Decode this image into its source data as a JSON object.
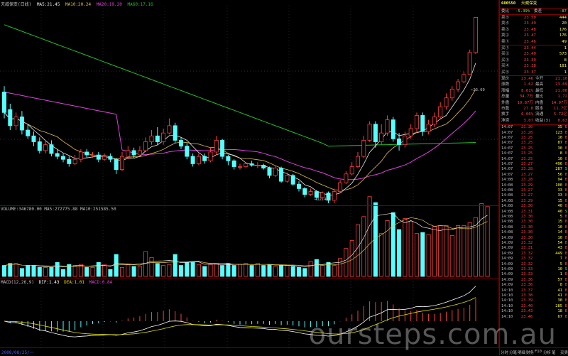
{
  "header": {
    "name": "天威保变(日线)",
    "ma5": "MA5:21.45",
    "ma10": "MA10:20.24",
    "ma20": "MA20:19.20",
    "ma60": "MA60:17.16"
  },
  "price_labels": {
    "high": "23.69",
    "low": "12.40"
  },
  "volume_header": "VOLUME:346780.00  MA5:272775.88  MA10:251585.50",
  "macd_header": {
    "params": "MACD(12,26,9)",
    "dif": "DIF:1.43",
    "dea": "DEA:1.01",
    "macd": "MACD:0.84"
  },
  "axis_date": "2008/08/25/一",
  "colors": {
    "up": "#ff3c3c",
    "down": "#54ffff",
    "ma5": "#e8e8e8",
    "ma10": "#e0c040",
    "ma20": "#e040e0",
    "ma60": "#20c020",
    "macd_dif": "#ffffff",
    "macd_dea": "#e0e000",
    "border": "#800000"
  },
  "candles": [
    {
      "o": 18.6,
      "c": 17.2,
      "h": 19.0,
      "l": 16.8
    },
    {
      "o": 17.4,
      "c": 16.3,
      "h": 17.8,
      "l": 16.0
    },
    {
      "o": 16.3,
      "c": 16.9,
      "h": 17.2,
      "l": 16.0
    },
    {
      "o": 16.9,
      "c": 16.0,
      "h": 17.3,
      "l": 15.7
    },
    {
      "o": 16.0,
      "c": 15.6,
      "h": 16.4,
      "l": 15.4
    },
    {
      "o": 15.6,
      "c": 15.2,
      "h": 15.9,
      "l": 14.9
    },
    {
      "o": 15.2,
      "c": 14.6,
      "h": 15.5,
      "l": 14.4
    },
    {
      "o": 14.6,
      "c": 15.0,
      "h": 15.3,
      "l": 14.4
    },
    {
      "o": 15.0,
      "c": 14.4,
      "h": 15.3,
      "l": 14.2
    },
    {
      "o": 14.4,
      "c": 14.2,
      "h": 14.7,
      "l": 14.0
    },
    {
      "o": 14.2,
      "c": 14.0,
      "h": 14.4,
      "l": 13.8
    },
    {
      "o": 14.0,
      "c": 13.7,
      "h": 14.2,
      "l": 13.5
    },
    {
      "o": 13.7,
      "c": 14.0,
      "h": 14.3,
      "l": 13.6
    },
    {
      "o": 14.0,
      "c": 14.5,
      "h": 14.7,
      "l": 13.8
    },
    {
      "o": 14.5,
      "c": 14.3,
      "h": 14.7,
      "l": 14.1
    },
    {
      "o": 14.3,
      "c": 14.3,
      "h": 14.5,
      "l": 14.1
    },
    {
      "o": 14.3,
      "c": 14.0,
      "h": 14.5,
      "l": 13.8
    },
    {
      "o": 14.0,
      "c": 14.2,
      "h": 14.4,
      "l": 13.9
    },
    {
      "o": 14.2,
      "c": 14.0,
      "h": 14.4,
      "l": 13.8
    },
    {
      "o": 14.0,
      "c": 13.3,
      "h": 14.1,
      "l": 13.0
    },
    {
      "o": 13.3,
      "c": 14.2,
      "h": 14.5,
      "l": 13.2
    },
    {
      "o": 14.2,
      "c": 14.6,
      "h": 14.9,
      "l": 14.0
    },
    {
      "o": 14.6,
      "c": 14.3,
      "h": 14.8,
      "l": 14.1
    },
    {
      "o": 14.3,
      "c": 14.6,
      "h": 14.9,
      "l": 14.2
    },
    {
      "o": 14.6,
      "c": 15.2,
      "h": 15.5,
      "l": 14.5
    },
    {
      "o": 15.2,
      "c": 15.6,
      "h": 16.0,
      "l": 15.0
    },
    {
      "o": 15.6,
      "c": 15.2,
      "h": 16.2,
      "l": 15.0
    },
    {
      "o": 15.2,
      "c": 15.8,
      "h": 16.1,
      "l": 15.0
    },
    {
      "o": 15.8,
      "c": 16.3,
      "h": 16.8,
      "l": 15.7
    },
    {
      "o": 16.3,
      "c": 15.3,
      "h": 16.5,
      "l": 15.1
    },
    {
      "o": 15.3,
      "c": 14.9,
      "h": 15.5,
      "l": 14.7
    },
    {
      "o": 14.9,
      "c": 14.2,
      "h": 15.1,
      "l": 14.0
    },
    {
      "o": 14.2,
      "c": 13.7,
      "h": 14.4,
      "l": 13.5
    },
    {
      "o": 13.7,
      "c": 14.2,
      "h": 14.4,
      "l": 13.6
    },
    {
      "o": 14.2,
      "c": 13.9,
      "h": 14.4,
      "l": 13.7
    },
    {
      "o": 13.9,
      "c": 14.5,
      "h": 14.8,
      "l": 13.8
    },
    {
      "o": 14.5,
      "c": 15.3,
      "h": 15.6,
      "l": 14.3
    },
    {
      "o": 15.3,
      "c": 14.2,
      "h": 15.4,
      "l": 14.0
    },
    {
      "o": 14.2,
      "c": 13.9,
      "h": 14.3,
      "l": 13.6
    },
    {
      "o": 13.9,
      "c": 13.5,
      "h": 14.0,
      "l": 13.3
    },
    {
      "o": 13.5,
      "c": 13.5,
      "h": 13.7,
      "l": 13.3
    },
    {
      "o": 13.5,
      "c": 13.7,
      "h": 13.8,
      "l": 13.4
    },
    {
      "o": 13.7,
      "c": 13.6,
      "h": 13.9,
      "l": 13.5
    },
    {
      "o": 13.6,
      "c": 13.6,
      "h": 13.8,
      "l": 13.4
    },
    {
      "o": 13.6,
      "c": 13.4,
      "h": 13.7,
      "l": 13.3
    },
    {
      "o": 13.4,
      "c": 12.9,
      "h": 13.5,
      "l": 12.7
    },
    {
      "o": 12.9,
      "c": 13.4,
      "h": 13.6,
      "l": 12.8
    },
    {
      "o": 13.4,
      "c": 12.5,
      "h": 13.5,
      "l": 12.4
    },
    {
      "o": 12.5,
      "c": 12.9,
      "h": 13.1,
      "l": 12.4
    },
    {
      "o": 12.9,
      "c": 12.3,
      "h": 13.0,
      "l": 12.2
    },
    {
      "o": 12.3,
      "c": 12.0,
      "h": 12.5,
      "l": 11.8
    },
    {
      "o": 12.0,
      "c": 11.6,
      "h": 12.1,
      "l": 11.4
    },
    {
      "o": 11.6,
      "c": 11.8,
      "h": 12.0,
      "l": 11.5
    },
    {
      "o": 11.8,
      "c": 11.4,
      "h": 11.9,
      "l": 11.2
    },
    {
      "o": 11.4,
      "c": 11.7,
      "h": 11.8,
      "l": 11.2
    },
    {
      "o": 11.7,
      "c": 11.2,
      "h": 11.8,
      "l": 11.0
    },
    {
      "o": 11.2,
      "c": 11.8,
      "h": 12.0,
      "l": 11.0
    },
    {
      "o": 11.8,
      "c": 12.4,
      "h": 12.6,
      "l": 11.7
    },
    {
      "o": 12.4,
      "c": 13.0,
      "h": 13.2,
      "l": 12.3
    },
    {
      "o": 13.0,
      "c": 13.5,
      "h": 13.8,
      "l": 12.9
    },
    {
      "o": 13.5,
      "c": 14.2,
      "h": 14.5,
      "l": 13.4
    },
    {
      "o": 14.2,
      "c": 15.3,
      "h": 15.6,
      "l": 14.1
    },
    {
      "o": 15.3,
      "c": 16.4,
      "h": 16.6,
      "l": 15.2
    },
    {
      "o": 16.4,
      "c": 15.2,
      "h": 16.6,
      "l": 14.8
    },
    {
      "o": 15.2,
      "c": 15.8,
      "h": 16.4,
      "l": 15.0
    },
    {
      "o": 15.8,
      "c": 16.7,
      "h": 17.0,
      "l": 15.6
    },
    {
      "o": 16.7,
      "c": 15.4,
      "h": 16.9,
      "l": 15.2
    },
    {
      "o": 15.4,
      "c": 15.0,
      "h": 15.8,
      "l": 14.6
    },
    {
      "o": 15.0,
      "c": 15.6,
      "h": 15.9,
      "l": 14.8
    },
    {
      "o": 15.6,
      "c": 16.1,
      "h": 16.4,
      "l": 15.4
    },
    {
      "o": 16.1,
      "c": 17.0,
      "h": 17.2,
      "l": 15.8
    },
    {
      "o": 17.0,
      "c": 15.9,
      "h": 17.2,
      "l": 15.6
    },
    {
      "o": 15.9,
      "c": 16.4,
      "h": 16.7,
      "l": 15.7
    },
    {
      "o": 16.4,
      "c": 16.9,
      "h": 17.2,
      "l": 16.2
    },
    {
      "o": 16.9,
      "c": 17.6,
      "h": 17.9,
      "l": 16.8
    },
    {
      "o": 17.6,
      "c": 18.2,
      "h": 18.5,
      "l": 17.4
    },
    {
      "o": 18.2,
      "c": 18.8,
      "h": 19.0,
      "l": 18.0
    },
    {
      "o": 18.8,
      "c": 19.3,
      "h": 19.5,
      "l": 18.6
    },
    {
      "o": 19.3,
      "c": 19.8,
      "h": 20.0,
      "l": 19.2
    },
    {
      "o": 19.8,
      "c": 21.3,
      "h": 21.5,
      "l": 19.8
    },
    {
      "o": 21.3,
      "c": 23.7,
      "h": 23.7,
      "l": 21.2
    }
  ],
  "volumes": [
    11,
    13,
    13,
    8,
    11,
    11,
    9,
    9,
    9,
    14,
    7,
    12,
    11,
    12,
    9,
    9,
    14,
    12,
    7,
    22,
    9,
    12,
    10,
    10,
    25,
    19,
    13,
    11,
    12,
    22,
    11,
    14,
    14,
    12,
    10,
    12,
    13,
    11,
    13,
    11,
    12,
    13,
    11,
    13,
    11,
    12,
    10,
    11,
    11,
    10,
    9,
    8,
    15,
    17,
    11,
    14,
    11,
    18,
    28,
    36,
    52,
    60,
    80,
    74,
    43,
    56,
    64,
    47,
    58,
    55,
    43,
    44,
    42,
    50,
    51,
    51,
    41,
    51,
    51,
    54,
    59,
    73,
    70
  ],
  "quote": {
    "code": "600550",
    "name": "天威保变",
    "weibi_label": "委比",
    "weibi_val": "-5.39%",
    "weicha_label": "委差",
    "weicha_val": "-87",
    "sells": [
      {
        "label": "卖⑤",
        "price": "23.50",
        "vol": "444"
      },
      {
        "label": "卖④",
        "price": "23.49",
        "vol": "20"
      },
      {
        "label": "卖③",
        "price": "23.48",
        "vol": "176"
      },
      {
        "label": "卖②",
        "price": "23.47",
        "vol": "176"
      },
      {
        "label": "卖①",
        "price": "23.46",
        "vol": "49"
      }
    ],
    "buys": [
      {
        "label": "买①",
        "price": "23.44",
        "vol": "1"
      },
      {
        "label": "买②",
        "price": "23.40",
        "vol": "573"
      },
      {
        "label": "买③",
        "price": "23.39",
        "vol": "8"
      },
      {
        "label": "买④",
        "price": "23.38",
        "vol": "181"
      },
      {
        "label": "买⑤",
        "price": "23.37",
        "vol": "1"
      }
    ],
    "stats": [
      {
        "l1": "现价",
        "v1": "23.46",
        "l2": "今开",
        "v2": "21.10"
      },
      {
        "l1": "涨跌",
        "v1": "1.62",
        "l2": "最高",
        "v2": "23.69"
      },
      {
        "l1": "涨幅",
        "v1": "8.61%",
        "l2": "最低",
        "v2": "21.00"
      },
      {
        "l1": "总量",
        "v1": "34.7万",
        "l2": "量比",
        "v2": "1.72"
      },
      {
        "l1": "外盘",
        "v1": "19.87万",
        "l2": "内盘",
        "v2": "14.97万"
      },
      {
        "l1": "市盈",
        "v1": "27.8",
        "l2": "股本",
        "v2": "11.7亿"
      },
      {
        "l1": "换手",
        "v1": "6.06%",
        "l2": "流通",
        "v2": "5.72亿"
      },
      {
        "l1": "净资",
        "v1": "3.07",
        "l2": "收益(3)",
        "v2": "0.63"
      }
    ],
    "ticks": [
      {
        "t": "14:07",
        "p": "23.30",
        "v": "35",
        "d": "B"
      },
      {
        "t": "14:07",
        "p": "23.28",
        "v": "123",
        "d": "B"
      },
      {
        "t": "14:07",
        "p": "23.25",
        "v": "10",
        "d": "B"
      },
      {
        "t": "14:07",
        "p": "23.25",
        "v": "87",
        "d": "B"
      },
      {
        "t": "14:07",
        "p": "23.25",
        "v": "30",
        "d": "B"
      },
      {
        "t": "14:07",
        "p": "23.25",
        "v": "8",
        "d": "B"
      },
      {
        "t": "14:07",
        "p": "23.25",
        "v": "10",
        "d": "B"
      },
      {
        "t": "14:07",
        "p": "23.27",
        "v": "496",
        "d": "B"
      },
      {
        "t": "14:07",
        "p": "23.28",
        "v": "287",
        "d": "S"
      },
      {
        "t": "14:07",
        "p": "23.27",
        "v": "56",
        "d": "B"
      },
      {
        "t": "14:08",
        "p": "23.28",
        "v": "94",
        "d": "B"
      },
      {
        "t": "14:08",
        "p": "23.29",
        "v": "100",
        "d": "B"
      },
      {
        "t": "14:08",
        "p": "23.27",
        "v": "33",
        "d": "B"
      },
      {
        "t": "14:08",
        "p": "23.27",
        "v": "33",
        "d": "B"
      },
      {
        "t": "14:08",
        "p": "23.29",
        "v": "15",
        "d": "B"
      },
      {
        "t": "14:08",
        "p": "23.30",
        "v": "40",
        "d": "B"
      },
      {
        "t": "14:08",
        "p": "23.31",
        "v": "40",
        "d": "S"
      },
      {
        "t": "14:08",
        "p": "23.30",
        "v": "5",
        "d": "B"
      },
      {
        "t": "14:08",
        "p": "23.30",
        "v": "15",
        "d": "B"
      },
      {
        "t": "14:08",
        "p": "23.30",
        "v": "10",
        "d": "B"
      },
      {
        "t": "14:08",
        "p": "23.30",
        "v": "14",
        "d": "B"
      },
      {
        "t": "14:09",
        "p": "23.30",
        "v": "10",
        "d": "B"
      },
      {
        "t": "14:09",
        "p": "23.32",
        "v": "54",
        "d": "B"
      },
      {
        "t": "14:09",
        "p": "23.31",
        "v": "43",
        "d": "B"
      },
      {
        "t": "14:09",
        "p": "23.32",
        "v": "449",
        "d": "B"
      },
      {
        "t": "14:09",
        "p": "23.32",
        "v": "7",
        "d": "B"
      },
      {
        "t": "14:09",
        "p": "23.32",
        "v": "5",
        "d": "B"
      },
      {
        "t": "14:09",
        "p": "23.33",
        "v": "10",
        "d": "S"
      },
      {
        "t": "14:09",
        "p": "23.33",
        "v": "1",
        "d": "B"
      },
      {
        "t": "14:09",
        "p": "23.36",
        "v": "57",
        "d": "B"
      },
      {
        "t": "14:09",
        "p": "23.36",
        "v": "8",
        "d": "B"
      },
      {
        "t": "14:10",
        "p": "23.37",
        "v": "41",
        "d": "B"
      },
      {
        "t": "14:10",
        "p": "23.38",
        "v": "41",
        "d": "B"
      },
      {
        "t": "14:10",
        "p": "23.39",
        "v": "30",
        "d": "B"
      },
      {
        "t": "14:10",
        "p": "23.40",
        "v": "285",
        "d": "B"
      },
      {
        "t": "14:10",
        "p": "23.43",
        "v": "18",
        "d": "B"
      },
      {
        "t": "14:10",
        "p": "23.46",
        "v": "67",
        "d": "B"
      }
    ]
  },
  "tabs": [
    "分时",
    "分笔",
    "明细",
    "财务",
    "F10",
    "分析",
    "笔",
    "买卖"
  ],
  "watermark": "oursteps.com.au"
}
